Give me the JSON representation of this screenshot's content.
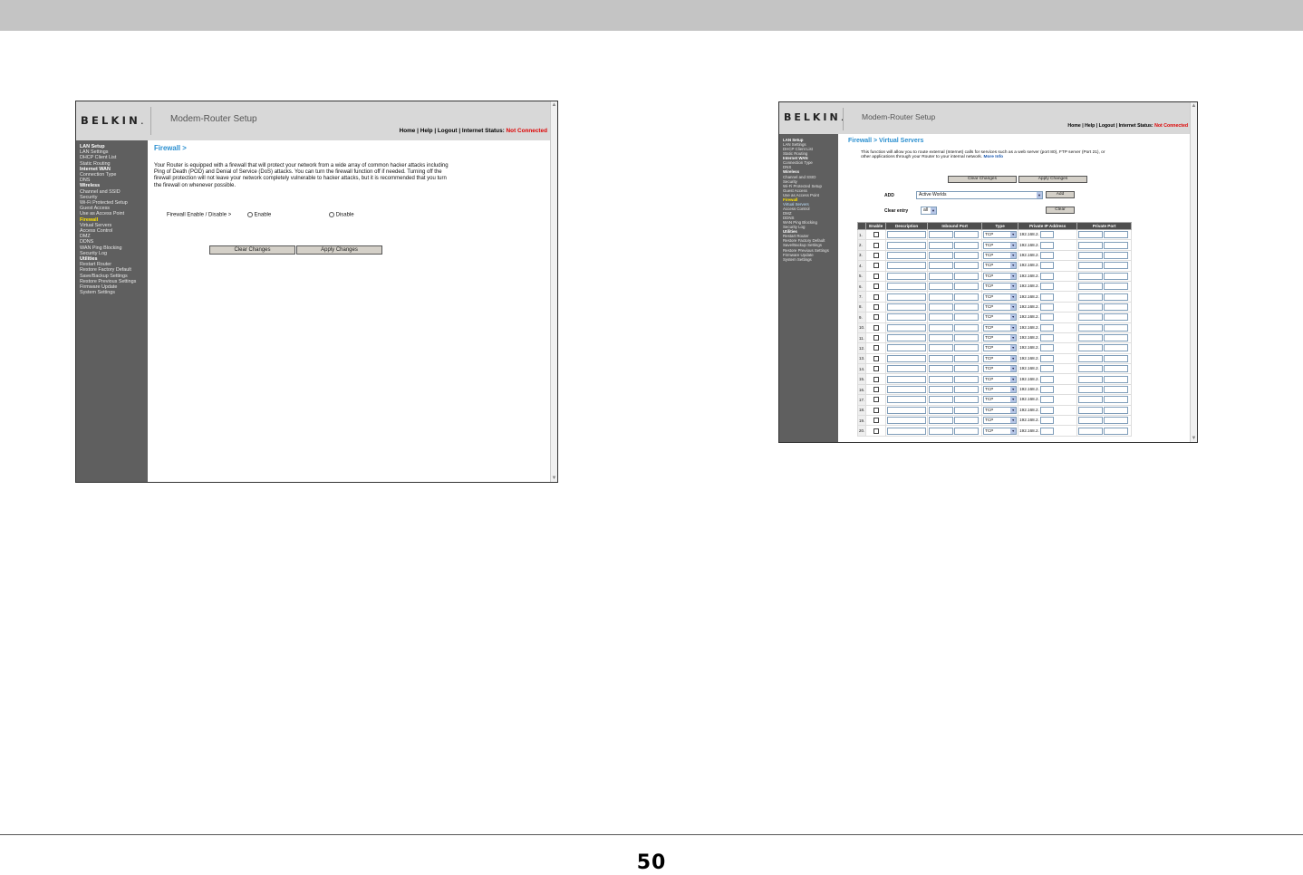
{
  "page_number": "50",
  "shot1": {
    "logo": "BELKIN",
    "logo_dot": ".",
    "app_title": "Modem-Router Setup",
    "top_links": "Home | Help | Logout",
    "internet_status_label": "Internet Status:",
    "internet_status_value": "Not Connected",
    "sidebar": [
      {
        "text": "LAN Setup",
        "kind": "h"
      },
      {
        "text": "LAN Settings",
        "kind": "i"
      },
      {
        "text": "DHCP Client List",
        "kind": "i"
      },
      {
        "text": "Static Routing",
        "kind": "i"
      },
      {
        "text": "Internet WAN",
        "kind": "h"
      },
      {
        "text": "Connection Type",
        "kind": "i"
      },
      {
        "text": "DNS",
        "kind": "i"
      },
      {
        "text": "Wireless",
        "kind": "h"
      },
      {
        "text": "Channel and SSID",
        "kind": "i"
      },
      {
        "text": "Security",
        "kind": "i"
      },
      {
        "text": "Wi-Fi Protected Setup",
        "kind": "i"
      },
      {
        "text": "Guest Access",
        "kind": "i"
      },
      {
        "text": "Use as Access Point",
        "kind": "i"
      },
      {
        "text": "Firewall",
        "kind": "act"
      },
      {
        "text": "Virtual Servers",
        "kind": "i"
      },
      {
        "text": "Access Control",
        "kind": "i"
      },
      {
        "text": "DMZ",
        "kind": "i"
      },
      {
        "text": "DDNS",
        "kind": "i"
      },
      {
        "text": "WAN Ping Blocking",
        "kind": "i"
      },
      {
        "text": "Security Log",
        "kind": "i"
      },
      {
        "text": "Utilities",
        "kind": "h"
      },
      {
        "text": "Restart Router",
        "kind": "i"
      },
      {
        "text": "Restore Factory Default",
        "kind": "i"
      },
      {
        "text": "Save/Backup Settings",
        "kind": "i"
      },
      {
        "text": "Restore Previous Settings",
        "kind": "i"
      },
      {
        "text": "Firmware Update",
        "kind": "i"
      },
      {
        "text": "System Settings",
        "kind": "i"
      }
    ],
    "page_title": "Firewall >",
    "description": "Your Router is equipped with a firewall that will protect your network from a wide array of common hacker attacks including Ping of Death (POD) and Denial of Service (DoS) attacks. You can turn the firewall function off if needed. Turning off the firewall protection will not leave your network completely vulnerable to hacker attacks, but it is recommended that you turn the firewall on whenever possible.",
    "firewall_label": "Firewall Enable / Disable >",
    "enable_label": "Enable",
    "disable_label": "Disable",
    "clear_button": "Clear Changes",
    "apply_button": "Apply Changes"
  },
  "shot2": {
    "logo": "BELKIN",
    "logo_dot": ".",
    "app_title": "Modem-Router Setup",
    "top_links": "Home | Help | Logout",
    "internet_status_label": "Internet Status:",
    "internet_status_value": "Not Connected",
    "sidebar": [
      {
        "text": "LAN Setup",
        "kind": "h"
      },
      {
        "text": "LAN Settings",
        "kind": "i"
      },
      {
        "text": "DHCP Client List",
        "kind": "i"
      },
      {
        "text": "Static Routing",
        "kind": "i"
      },
      {
        "text": "Internet WAN",
        "kind": "h"
      },
      {
        "text": "Connection Type",
        "kind": "i"
      },
      {
        "text": "DNS",
        "kind": "i"
      },
      {
        "text": "Wireless",
        "kind": "h"
      },
      {
        "text": "Channel and SSID",
        "kind": "i"
      },
      {
        "text": "Security",
        "kind": "i"
      },
      {
        "text": "Wi-Fi Protected Setup",
        "kind": "i"
      },
      {
        "text": "Guest Access",
        "kind": "i"
      },
      {
        "text": "Use as Access Point",
        "kind": "i"
      },
      {
        "text": "Firewall",
        "kind": "act"
      },
      {
        "text": "Virtual Servers",
        "kind": "sub"
      },
      {
        "text": "Access Control",
        "kind": "i"
      },
      {
        "text": "DMZ",
        "kind": "i"
      },
      {
        "text": "DDNS",
        "kind": "i"
      },
      {
        "text": "WAN Ping Blocking",
        "kind": "i"
      },
      {
        "text": "Security Log",
        "kind": "i"
      },
      {
        "text": "Utilities",
        "kind": "h"
      },
      {
        "text": "Restart Router",
        "kind": "i"
      },
      {
        "text": "Restore Factory Default",
        "kind": "i"
      },
      {
        "text": "Save/Backup Settings",
        "kind": "i"
      },
      {
        "text": "Restore Previous Settings",
        "kind": "i"
      },
      {
        "text": "Firmware Update",
        "kind": "i"
      },
      {
        "text": "System Settings",
        "kind": "i"
      }
    ],
    "page_title": "Firewall > Virtual Servers",
    "description": "This function will allow you to route external (Internet) calls for services such as a web server (port 80), FTP server (Port 21), or other applications through your Router to your internal network.",
    "more_info": "More Info",
    "clear_button": "Clear Changes",
    "apply_button": "Apply Changes",
    "add_label": "ADD",
    "add_select_value": "Active Worlds",
    "add_button": "Add",
    "clear_entry_label": "Clear entry",
    "clear_entry_value": "all",
    "clear_entry_button": "Clear",
    "columns": [
      "",
      "Enable",
      "Description",
      "Inbound Port",
      "Type",
      "Private IP Address",
      "Private Port"
    ],
    "default_type": "TCP",
    "ip_prefix": "192.168.2.",
    "rows": [
      "1.",
      "2.",
      "3.",
      "4.",
      "5.",
      "6.",
      "7.",
      "8.",
      "9.",
      "10.",
      "11.",
      "12.",
      "13.",
      "14.",
      "15.",
      "16.",
      "17.",
      "18.",
      "19.",
      "20."
    ]
  },
  "icons": {
    "scroll_up": "scroll-up-arrow-icon",
    "scroll_down": "scroll-down-arrow-icon",
    "dropdown": "dropdown-arrow-icon"
  },
  "colors": {
    "sidebar_bg": "#5f5f5f",
    "active_nav": "#ffe400",
    "title_blue": "#2a8fd0",
    "status_red": "#dd0000",
    "table_header": "#4e4e4e"
  }
}
